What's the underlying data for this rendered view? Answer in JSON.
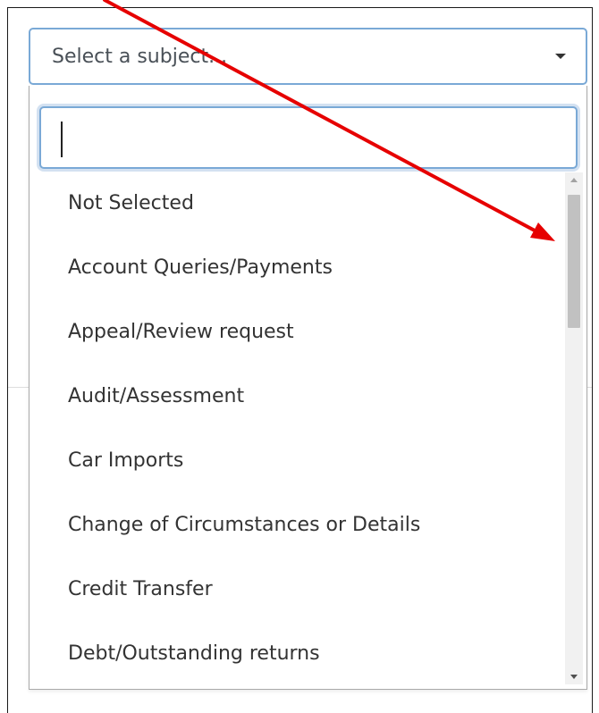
{
  "select": {
    "placeholder": "Select a subject...",
    "caret_icon": "caret-down-icon"
  },
  "search": {
    "value": "",
    "placeholder": ""
  },
  "options": [
    "Not Selected",
    "Account Queries/Payments",
    "Appeal/Review request",
    "Audit/Assessment",
    "Car Imports",
    "Change of Circumstances or Details",
    "Credit Transfer",
    "Debt/Outstanding returns"
  ],
  "colors": {
    "focus_border": "#7aa9d6",
    "annotation_arrow": "#e60000",
    "scroll_thumb": "#c1c1c1"
  }
}
